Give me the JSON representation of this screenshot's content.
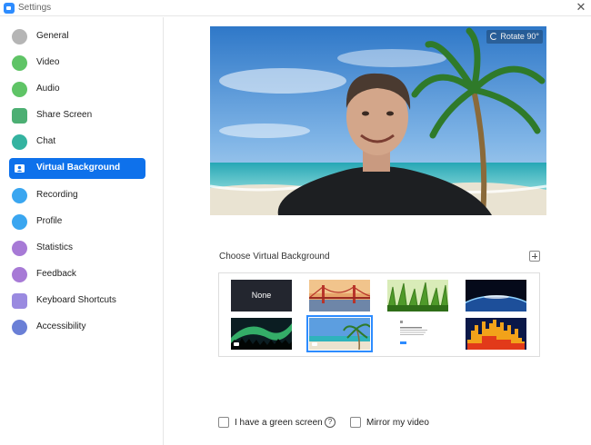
{
  "window": {
    "title": "Settings"
  },
  "sidebar": {
    "items": [
      {
        "label": "General",
        "icon": "gear-icon",
        "color": "#b5b5b5",
        "active": false
      },
      {
        "label": "Video",
        "icon": "video-icon",
        "color": "#5fc466",
        "active": false
      },
      {
        "label": "Audio",
        "icon": "headphones-icon",
        "color": "#5fc466",
        "active": false
      },
      {
        "label": "Share Screen",
        "icon": "share-screen-icon",
        "color": "#4caf73",
        "active": false
      },
      {
        "label": "Chat",
        "icon": "chat-icon",
        "color": "#34b3a0",
        "active": false
      },
      {
        "label": "Virtual Background",
        "icon": "person-background-icon",
        "color": "#ffffff",
        "active": true
      },
      {
        "label": "Recording",
        "icon": "recording-icon",
        "color": "#3aa6f0",
        "active": false
      },
      {
        "label": "Profile",
        "icon": "profile-icon",
        "color": "#3aa6f0",
        "active": false
      },
      {
        "label": "Statistics",
        "icon": "statistics-icon",
        "color": "#a77ad6",
        "active": false
      },
      {
        "label": "Feedback",
        "icon": "feedback-icon",
        "color": "#a77ad6",
        "active": false
      },
      {
        "label": "Keyboard Shortcuts",
        "icon": "keyboard-icon",
        "color": "#9a8ae0",
        "active": false
      },
      {
        "label": "Accessibility",
        "icon": "accessibility-icon",
        "color": "#6a7fd6",
        "active": false
      }
    ],
    "active_color": "#0e71eb"
  },
  "preview": {
    "rotate_label": "Rotate 90°"
  },
  "backgrounds": {
    "heading": "Choose Virtual Background",
    "none_label": "None",
    "items": [
      "none",
      "golden-gate-bridge",
      "grass",
      "earth-from-space",
      "aurora",
      "beach",
      "document",
      "audio-waveform"
    ],
    "selected": "beach"
  },
  "options": {
    "green_screen": {
      "label": "I have a green screen",
      "checked": false
    },
    "mirror": {
      "label": "Mirror my video",
      "checked": false
    }
  }
}
